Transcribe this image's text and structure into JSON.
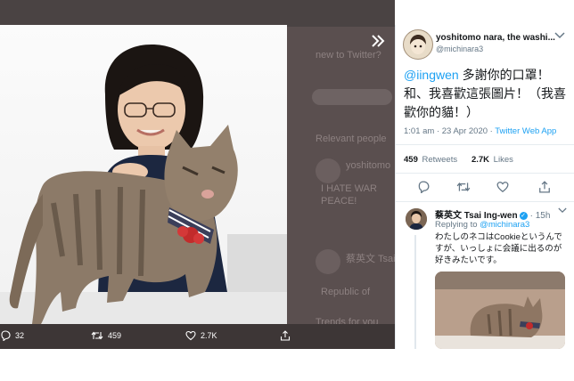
{
  "backdrop": {
    "ghost_texts": [
      "new to Twitter?",
      "Relevant people",
      "yoshitomo",
      "I HATE WAR",
      "PEACE!",
      "蔡英文 Tsai",
      "Republic of",
      "Trends for you"
    ]
  },
  "media_actions": {
    "reply_count": "32",
    "retweet_count": "459",
    "like_count": "2.7K"
  },
  "tweet": {
    "author_name": "yoshitomo nara, the washi...",
    "author_handle": "@michinara3",
    "mention": "@iingwen",
    "text_after_mention": " 多謝你的口罩！和、我喜歡這張圖片！（我喜歡你的貓！）",
    "timestamp": "1:01 am · 23 Apr 2020 ·",
    "source": "Twitter Web App",
    "retweets_value": "459",
    "retweets_label": "Retweets",
    "likes_value": "2.7K",
    "likes_label": "Likes"
  },
  "reply": {
    "author_name": "蔡英文 Tsai Ing-wen",
    "time": "· 15h",
    "replying_prefix": "Replying to",
    "replying_handle": "@michinara3",
    "text": "わたしのネコはCookieというんですが、いっしょに会議に出るのが好きみたいです。"
  },
  "colors": {
    "link": "#1da1f2",
    "secondary_text": "#657786",
    "backdrop": "#4a4343"
  }
}
